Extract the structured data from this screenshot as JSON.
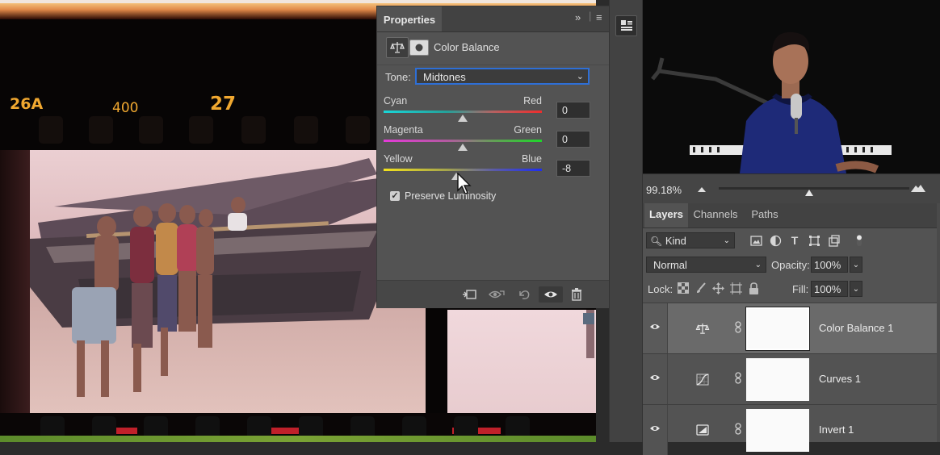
{
  "canvas": {
    "film_edge_codes": [
      "26A",
      "400",
      "27"
    ]
  },
  "properties_panel": {
    "tab_title": "Properties",
    "adjustment_title": "Color Balance",
    "tone_label": "Tone:",
    "tone_value": "Midtones",
    "sliders": [
      {
        "left": "Cyan",
        "right": "Red",
        "value": "0",
        "level": 0
      },
      {
        "left": "Magenta",
        "right": "Green",
        "value": "0",
        "level": 0
      },
      {
        "left": "Yellow",
        "right": "Blue",
        "value": "-8",
        "level": -8
      }
    ],
    "preserve_luminosity_label": "Preserve Luminosity",
    "preserve_luminosity_checked": true
  },
  "navigator": {
    "zoom": "99.18%"
  },
  "layers_panel": {
    "tabs": [
      "Layers",
      "Channels",
      "Paths"
    ],
    "active_tab": "Layers",
    "filter_kind": "Kind",
    "blend_mode": "Normal",
    "opacity_label": "Opacity:",
    "opacity_value": "100%",
    "lock_label": "Lock:",
    "fill_label": "Fill:",
    "fill_value": "100%",
    "layers": [
      {
        "name": "Color Balance 1",
        "icon": "color-balance-icon",
        "selected": true
      },
      {
        "name": "Curves 1",
        "icon": "curves-icon",
        "selected": false
      },
      {
        "name": "Invert 1",
        "icon": "invert-icon",
        "selected": false
      }
    ]
  },
  "colors": {
    "panel_bg": "#535353",
    "tab_bar_bg": "#424242",
    "select_focus": "#2e6fd6",
    "selected_layer_bg": "#6a6a6a"
  }
}
